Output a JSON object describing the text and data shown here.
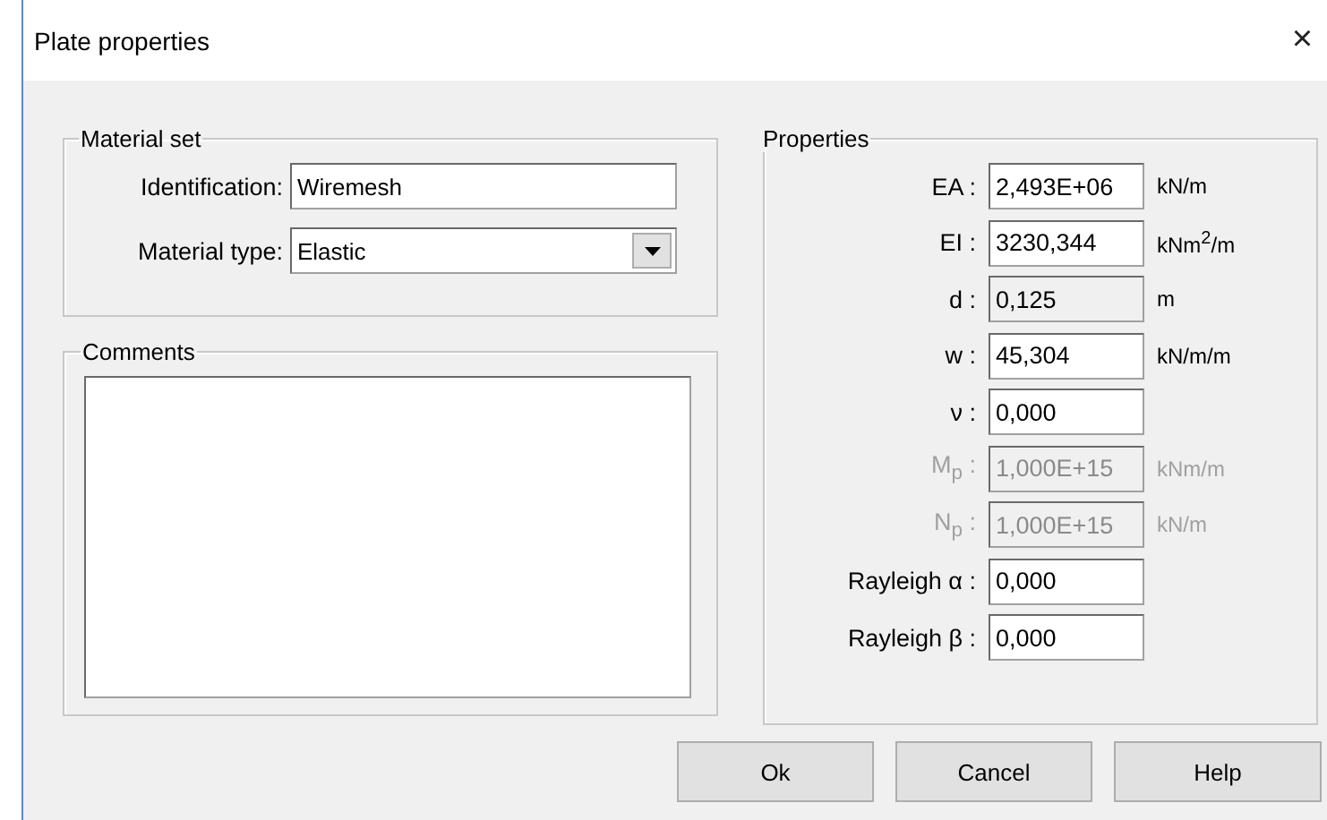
{
  "window": {
    "title": "Plate properties",
    "close": "×"
  },
  "material_set": {
    "title": "Material set",
    "identification": {
      "label": "Identification:",
      "value": "Wiremesh"
    },
    "material_type": {
      "label": "Material type:",
      "value": "Elastic"
    }
  },
  "comments": {
    "title": "Comments"
  },
  "properties": {
    "title": "Properties",
    "rows": [
      {
        "label": "EA :",
        "value": "2,493E+06",
        "unit": "kN/m",
        "disabled": false,
        "read_only": false
      },
      {
        "label": "EI :",
        "value": "3230,344",
        "unit": "kNm$^{2}$/m",
        "disabled": false,
        "read_only": false
      },
      {
        "label": "d :",
        "value": "0,125",
        "unit": "m",
        "disabled": false,
        "read_only": true
      },
      {
        "label": "w :",
        "value": "45,304",
        "unit": "kN/m/m",
        "disabled": false,
        "read_only": false
      },
      {
        "label": "ν :",
        "value": "0,000",
        "disabled": false,
        "read_only": false
      },
      {
        "label": "M$_{p}$ :",
        "value": "1,000E+15",
        "unit": "kNm/m",
        "disabled": true,
        "read_only": true
      },
      {
        "label": "N$_{p}$ :",
        "value": "1,000E+15",
        "unit": "kN/m",
        "disabled": true,
        "read_only": true
      },
      {
        "label": "Rayleigh α :",
        "value": "0,000",
        "disabled": false,
        "read_only": false
      },
      {
        "label": "Rayleigh β :",
        "value": "0,000",
        "disabled": false,
        "read_only": false
      }
    ]
  },
  "buttons": [
    {
      "label": "Ok"
    },
    {
      "label": "Cancel"
    },
    {
      "label": "Help"
    }
  ]
}
